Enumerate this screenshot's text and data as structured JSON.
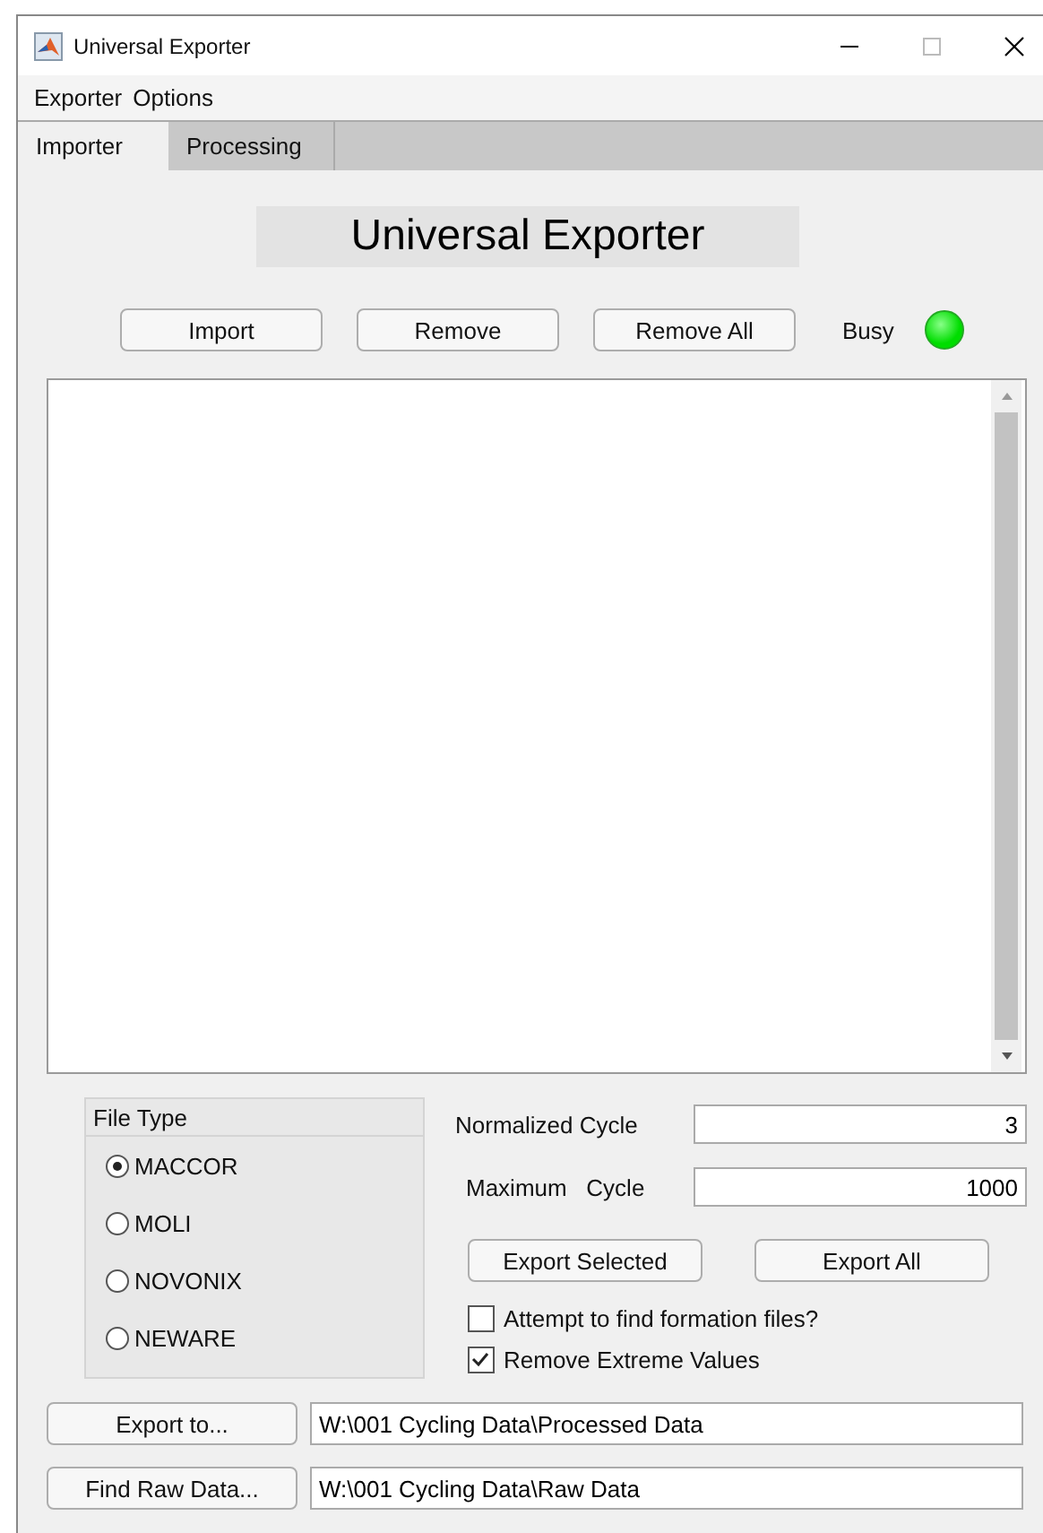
{
  "window": {
    "title": "Universal Exporter"
  },
  "menu": [
    "Exporter",
    "Options"
  ],
  "tabs": [
    {
      "label": "Importer",
      "selected": true
    },
    {
      "label": "Processing",
      "selected": false
    }
  ],
  "heading": "Universal Exporter",
  "actions": [
    "Import",
    "Remove",
    "Remove All"
  ],
  "busy": {
    "label": "Busy",
    "lit": true
  },
  "file_type": {
    "title": "File Type",
    "options": [
      {
        "label": "MACCOR",
        "selected": true
      },
      {
        "label": "MOLI",
        "selected": false
      },
      {
        "label": "NOVONIX",
        "selected": false
      },
      {
        "label": "NEWARE",
        "selected": false
      }
    ]
  },
  "fields": [
    {
      "label": "Normalized Cycle",
      "value": "3"
    },
    {
      "label": "Maximum   Cycle",
      "value": "1000"
    }
  ],
  "export_buttons": [
    "Export Selected",
    "Export All"
  ],
  "checkboxes": [
    {
      "label": "Attempt to find formation files?",
      "checked": false
    },
    {
      "label": "Remove Extreme Values",
      "checked": true
    }
  ],
  "paths": [
    {
      "button": "Export to...",
      "value": "W:\\001 Cycling Data\\Processed Data"
    },
    {
      "button": "Find Raw Data...",
      "value": "W:\\001 Cycling Data\\Raw Data"
    }
  ]
}
